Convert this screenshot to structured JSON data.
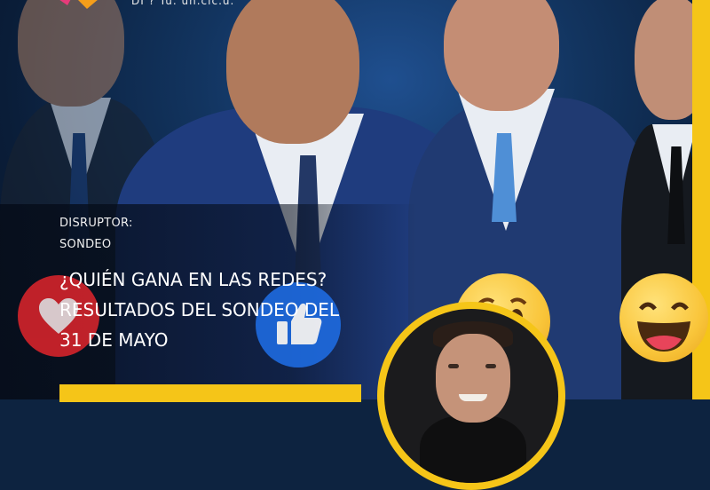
{
  "header": {
    "logo_text": "DI ? Tu. un.cic.u."
  },
  "article": {
    "kicker_line1": "DISRUPTOR:",
    "kicker_line2": "SONDEO",
    "headline_line1": "¿QUIÉN GANA EN LAS REDES?",
    "headline_line2": "RESULTADOS DEL SONDEO DEL",
    "headline_line3": "31 DE MAYO"
  },
  "icons": {
    "heart": "heart-reaction-icon",
    "like": "thumbs-up-reaction-icon",
    "wow": "wow-emoji-icon",
    "laugh": "laugh-emoji-icon"
  },
  "colors": {
    "accent": "#f5c518",
    "like_blue": "#1e6be0",
    "heart_red": "#e0252c",
    "background": "#12345f"
  }
}
